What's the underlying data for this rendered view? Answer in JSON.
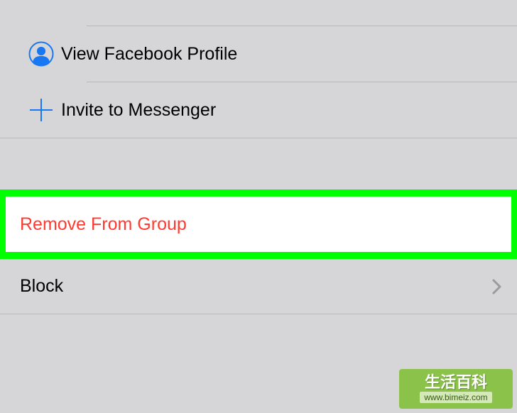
{
  "menu": {
    "view_profile": "View Facebook Profile",
    "invite": "Invite to Messenger",
    "remove": "Remove From Group",
    "block": "Block"
  },
  "watermark": {
    "cn": "生活百科",
    "url": "www.bimeiz.com"
  },
  "icons": {
    "profile": "profile-silhouette",
    "plus": "plus",
    "chevron": "chevron-right"
  },
  "colors": {
    "highlight": "#00ff00",
    "destructive": "#ff3b30",
    "accent_blue": "#1877f2",
    "bg": "#d6d6d9"
  }
}
